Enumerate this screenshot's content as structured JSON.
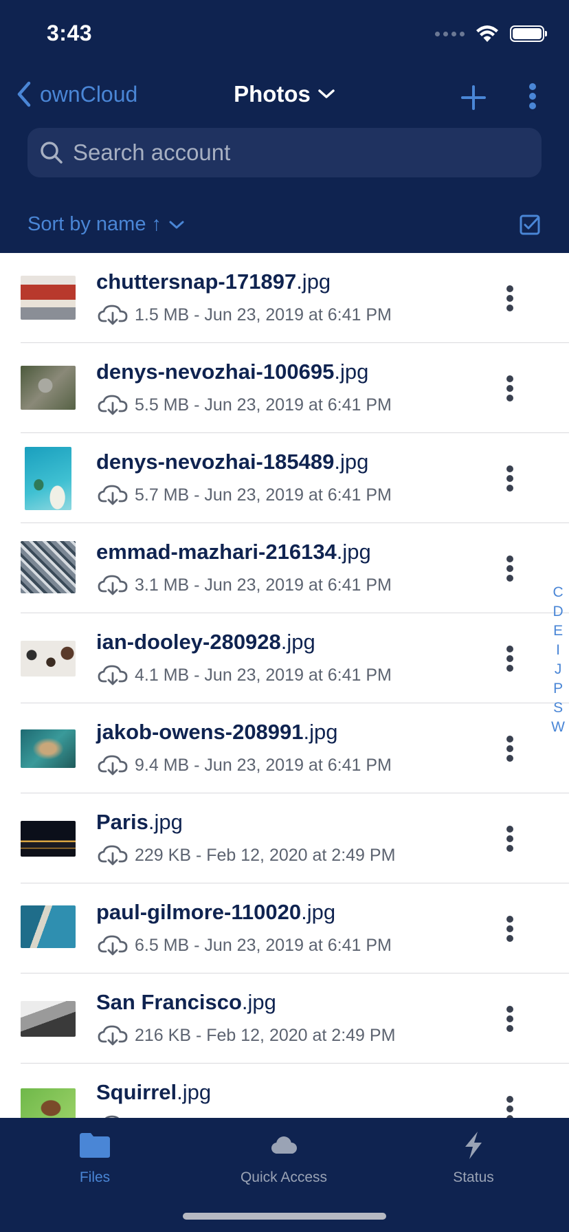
{
  "status_bar": {
    "time": "3:43"
  },
  "nav": {
    "back_label": "ownCloud",
    "title": "Photos"
  },
  "search": {
    "placeholder": "Search account"
  },
  "sort": {
    "label": "Sort by name ↑"
  },
  "files": [
    {
      "name": "chuttersnap-171897",
      "ext": ".jpg",
      "size": "1.5 MB",
      "date": "Jun 23, 2019 at 6:41 PM",
      "meta": "1.5 MB - Jun 23, 2019 at 6:41 PM"
    },
    {
      "name": "denys-nevozhai-100695",
      "ext": ".jpg",
      "size": "5.5 MB",
      "date": "Jun 23, 2019 at 6:41 PM",
      "meta": "5.5 MB - Jun 23, 2019 at 6:41 PM"
    },
    {
      "name": "denys-nevozhai-185489",
      "ext": ".jpg",
      "size": "5.7 MB",
      "date": "Jun 23, 2019 at 6:41 PM",
      "meta": "5.7 MB - Jun 23, 2019 at 6:41 PM"
    },
    {
      "name": "emmad-mazhari-216134",
      "ext": ".jpg",
      "size": "3.1 MB",
      "date": "Jun 23, 2019 at 6:41 PM",
      "meta": "3.1 MB - Jun 23, 2019 at 6:41 PM"
    },
    {
      "name": "ian-dooley-280928",
      "ext": ".jpg",
      "size": "4.1 MB",
      "date": "Jun 23, 2019 at 6:41 PM",
      "meta": "4.1 MB - Jun 23, 2019 at 6:41 PM"
    },
    {
      "name": "jakob-owens-208991",
      "ext": ".jpg",
      "size": "9.4 MB",
      "date": "Jun 23, 2019 at 6:41 PM",
      "meta": "9.4 MB - Jun 23, 2019 at 6:41 PM"
    },
    {
      "name": "Paris",
      "ext": ".jpg",
      "size": "229 KB",
      "date": "Feb 12, 2020 at 2:49 PM",
      "meta": "229 KB - Feb 12, 2020 at 2:49 PM"
    },
    {
      "name": "paul-gilmore-110020",
      "ext": ".jpg",
      "size": "6.5 MB",
      "date": "Jun 23, 2019 at 6:41 PM",
      "meta": "6.5 MB - Jun 23, 2019 at 6:41 PM"
    },
    {
      "name": "San Francisco",
      "ext": ".jpg",
      "size": "216 KB",
      "date": "Feb 12, 2020 at 2:49 PM",
      "meta": "216 KB - Feb 12, 2020 at 2:49 PM"
    },
    {
      "name": "Squirrel",
      "ext": ".jpg",
      "size": "",
      "date": "",
      "meta": ""
    }
  ],
  "section_index": [
    "C",
    "D",
    "E",
    "I",
    "J",
    "P",
    "S",
    "W"
  ],
  "tabs": {
    "files": "Files",
    "quick_access": "Quick Access",
    "status": "Status"
  },
  "colors": {
    "header_bg": "#0f2350",
    "accent": "#4a86d6",
    "search_bg": "#1f3260",
    "filename": "#0f2350",
    "meta_text": "#5c6370"
  }
}
